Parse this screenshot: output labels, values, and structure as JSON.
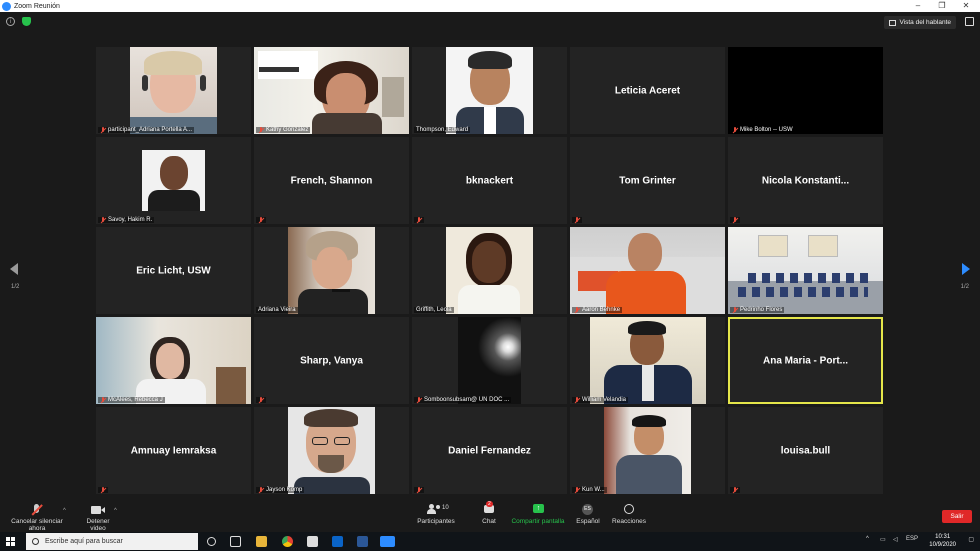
{
  "window": {
    "title": "Zoom Reunión",
    "minimize": "–",
    "restore": "❐",
    "close": "✕"
  },
  "topbar": {
    "speaker_view": "Vista del hablante"
  },
  "colors": {
    "accent": "#2d8cff",
    "active_speaker": "#e5e64a",
    "muted": "#e74c3c",
    "leave": "#e02828",
    "share": "#27c24c"
  },
  "gallery": {
    "page_indicator": "1/2",
    "tiles": [
      {
        "big": "",
        "label": "participant_Adriana Portella A...",
        "video": true
      },
      {
        "big": "",
        "label": "Kathy Gonzalez",
        "video": true
      },
      {
        "big": "",
        "label": "Thompson, Edward",
        "video": true
      },
      {
        "big": "Leticia Aceret",
        "label": "",
        "video": false
      },
      {
        "big": "",
        "label": "Mike Bolton -- USW",
        "video": true
      },
      {
        "big": "",
        "label": "Savoy, Hakim R.",
        "video": true
      },
      {
        "big": "French, Shannon",
        "label": "",
        "video": false
      },
      {
        "big": "bknackert",
        "label": "",
        "video": false
      },
      {
        "big": "Tom Grinter",
        "label": "",
        "video": false
      },
      {
        "big": "Nicola  Konstanti...",
        "label": "",
        "video": false
      },
      {
        "big": "Eric Licht, USW",
        "label": "",
        "video": false
      },
      {
        "big": "",
        "label": "Adriana Vieira",
        "video": true
      },
      {
        "big": "",
        "label": "Griffith, Leola",
        "video": true
      },
      {
        "big": "",
        "label": "Aaron Behnke",
        "video": true
      },
      {
        "big": "",
        "label": "Pedrinho Flores",
        "video": true
      },
      {
        "big": "",
        "label": "McAlees, Rebecca J",
        "video": true
      },
      {
        "big": "Sharp, Vanya",
        "label": "",
        "video": false
      },
      {
        "big": "",
        "label": "Somboonsubsarn@ UN DOC ...",
        "video": true
      },
      {
        "big": "",
        "label": "William Velandia",
        "video": true
      },
      {
        "big": "Ana Maria - Port...",
        "label": "",
        "video": false
      },
      {
        "big": "Amnuay Iemraksa",
        "label": "",
        "video": false
      },
      {
        "big": "",
        "label": "Jayson Komp",
        "video": true
      },
      {
        "big": "Daniel Fernandez",
        "label": "",
        "video": false
      },
      {
        "big": "",
        "label": "Kun W...",
        "video": true
      },
      {
        "big": "louisa.bull",
        "label": "",
        "video": false
      }
    ]
  },
  "toolbar": {
    "unmute": "Cancelar silenciar ahora",
    "stop_video": "Detener video",
    "participants": "Participantes",
    "participants_count": "10",
    "chat": "Chat",
    "chat_badge": "2",
    "share": "Compartir pantalla",
    "language": "Español",
    "language_code": "ES",
    "reactions": "Reacciones",
    "leave": "Salir",
    "caret": "^"
  },
  "taskbar": {
    "search_placeholder": "Escribe aquí para buscar",
    "lang": "ESP",
    "time": "10:31",
    "date": "10/9/2020"
  }
}
